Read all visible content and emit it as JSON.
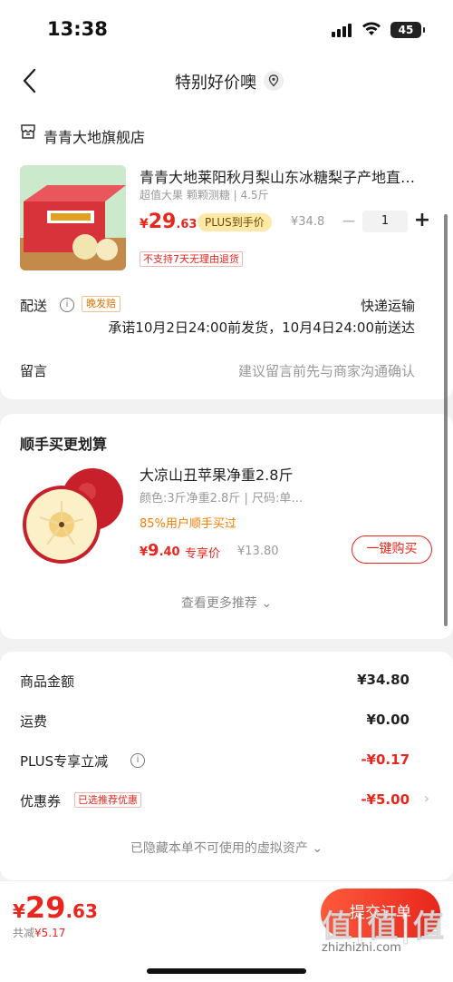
{
  "status_bar": {
    "time": "13:38",
    "battery": "45"
  },
  "nav": {
    "title": "特别好价噢"
  },
  "store": {
    "name": "青青大地旗舰店"
  },
  "product": {
    "title": "青青大地莱阳秋月梨山东冰糖梨子产地直…",
    "spec": "超值大果 颗颗测糖 | 4.5斤",
    "price_currency": "¥",
    "price_int": "29",
    "price_dec": ".63",
    "plus_badge": "PLUS到手价",
    "original_price": "¥34.8",
    "qty_minus": "−",
    "quantity": "1",
    "qty_plus": "+",
    "return_note": "不支持7天无理由退货"
  },
  "delivery": {
    "label": "配送",
    "tag": "晚发赔",
    "method": "快递运输",
    "promise": "承诺10月2日24:00前发货，10月4日24:00前送达"
  },
  "remark": {
    "label": "留言",
    "placeholder": "建议留言前先与商家沟通确认"
  },
  "recommend": {
    "section_title": "顺手买更划算",
    "title": "大凉山丑苹果净重2.8斤",
    "spec": "颜色:3斤净重2.8斤 | 尺码:单…",
    "social": "85%用户顺手买过",
    "price_currency": "¥",
    "price_int": "9",
    "price_dec": ".40",
    "price_label": "专享价",
    "original_price": "¥13.80",
    "buy_label": "一键购买",
    "see_more": "查看更多推荐 ⌄"
  },
  "summary": {
    "rows": [
      {
        "label": "商品金额",
        "value": "¥34.80"
      },
      {
        "label": "运费",
        "value": "¥0.00"
      },
      {
        "label": "PLUS专享立减",
        "value": "-¥0.17"
      },
      {
        "label": "优惠券",
        "value": "-¥5.00"
      }
    ],
    "coupon_tag": "已选推荐优惠",
    "hidden_assets": "已隐藏本单不可使用的虚拟资产 ⌄"
  },
  "footer": {
    "total_currency": "¥",
    "total_int": "29",
    "total_dec": ".63",
    "saved_label": "共减",
    "saved_value": "¥5.17",
    "submit_label": "提交订单",
    "watermark": "值|值|值",
    "watermark_url": "zhizhizhi.com"
  },
  "colors": {
    "accent": "#e8261d",
    "plus": "#ffe9a8",
    "orange": "#ff7a00"
  }
}
